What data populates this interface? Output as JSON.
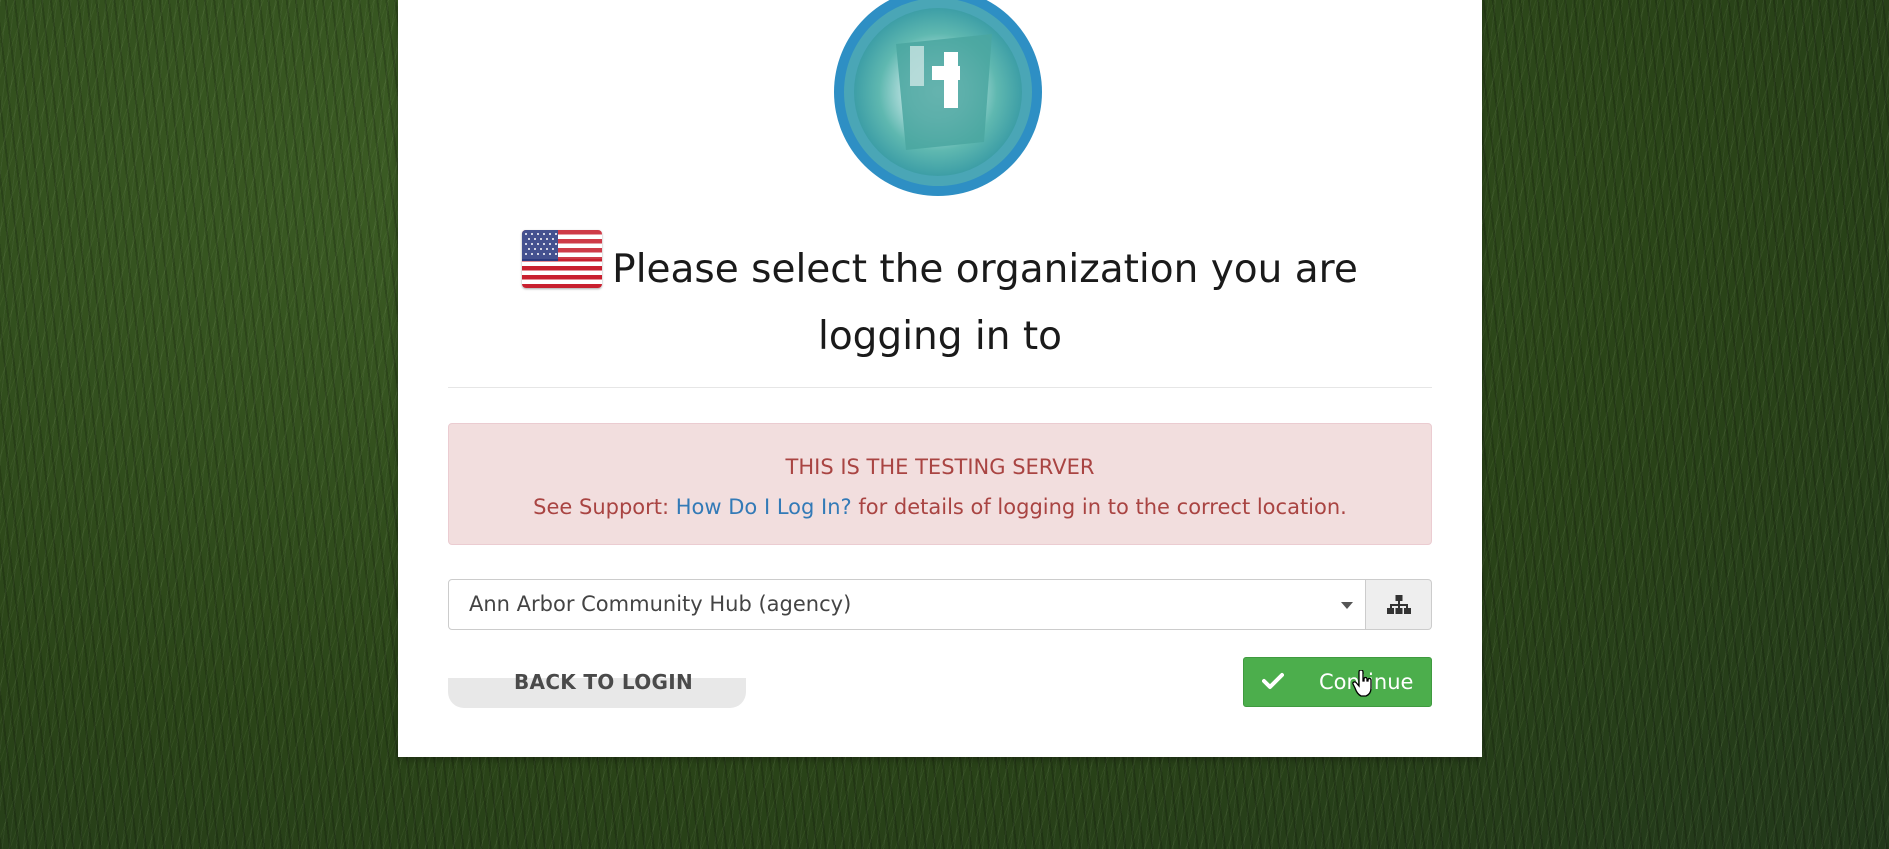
{
  "heading": {
    "text": "Please select the organization you are logging in to",
    "flag_icon": "us-flag-icon"
  },
  "logo": {
    "icon": "app-logo-icon",
    "colors": {
      "outer": "#2e8fc4",
      "inner": "#5fb8b0",
      "accent": "#ffffff"
    }
  },
  "alert": {
    "title": "THIS IS THE TESTING SERVER",
    "prefix": "See Support: ",
    "link_text": "How Do I Log In?",
    "suffix": " for details of logging in to the correct location.",
    "text_color": "#a94442",
    "background_color": "#f2dede",
    "link_color": "#337ab7"
  },
  "org_select": {
    "selected_value": "Ann Arbor Community Hub (agency)",
    "caret_icon": "chevron-down-icon",
    "tree_button_icon": "sitemap-icon"
  },
  "actions": {
    "back_label": "BACK TO LOGIN",
    "continue_label": "Continue",
    "continue_icon": "check-icon",
    "continue_color": "#4cae4c"
  }
}
